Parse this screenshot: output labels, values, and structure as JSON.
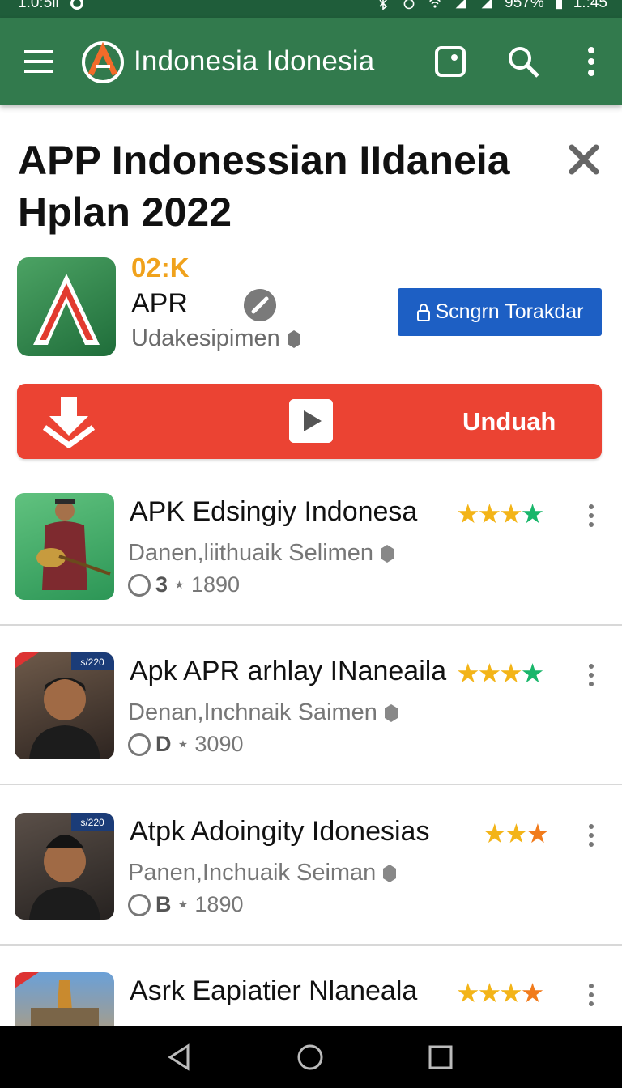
{
  "status_bar": {
    "time_left": "1.0:5ll",
    "battery": "957%",
    "time_right": "1.:45"
  },
  "app_bar": {
    "title": "Indonesia Idonesia"
  },
  "page": {
    "heading": "APP Indonessian IIdaneia Hplan 2022"
  },
  "app": {
    "stat": "02:K",
    "name": "APR",
    "publisher": "Udakesipimen",
    "signin_label": "Scngrn Torakdar",
    "download_label": "Unduah"
  },
  "list": [
    {
      "title": "APK Edsingiy Indonesa",
      "subtitle": "Danen,liithuaik Selimen",
      "meta_letter": "3",
      "meta_number": "1890",
      "stars": "★★★",
      "star_last": "★",
      "last_color": "green"
    },
    {
      "title": "Apk APR arhlay INaneaila",
      "subtitle": "Denan,Inchnaik Saimen",
      "meta_letter": "D",
      "meta_number": "3090",
      "stars": "★★★",
      "star_last": "★",
      "last_color": "green",
      "thumb_badge": "s/220"
    },
    {
      "title": "Atpk Adoingity Idonesias",
      "subtitle": "Panen,Inchuaik Seiman",
      "meta_letter": "B",
      "meta_number": "1890",
      "stars": "★★",
      "star_last": "★",
      "last_color": "orange",
      "thumb_badge": "s/220"
    },
    {
      "title": "Asrk Eapiatier Nlaneala",
      "stars": "★★★",
      "star_last": "★",
      "last_color": "orange"
    }
  ],
  "colors": {
    "appbar": "#327a4d",
    "download": "#eb4333",
    "signin": "#1d5fc4",
    "stat": "#f0a21c"
  },
  "icons": [
    "menu-icon",
    "app-logo-icon",
    "scan-icon",
    "search-icon",
    "more-vert-icon",
    "close-icon",
    "share-link-icon",
    "lock-icon",
    "download-icon",
    "play-icon",
    "back-icon",
    "home-icon",
    "recents-icon"
  ]
}
